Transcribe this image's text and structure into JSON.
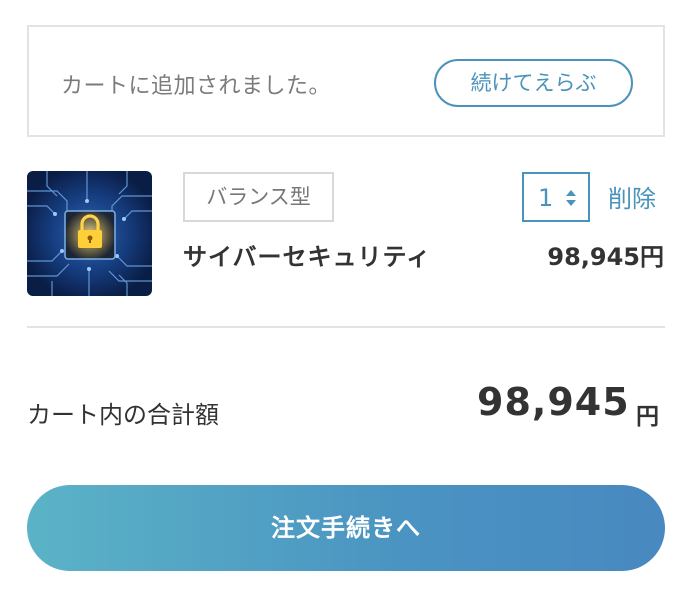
{
  "notice": {
    "message": "カートに追加されました。",
    "continue_label": "続けてえらぶ"
  },
  "item": {
    "image_icon": "padlock-circuit-image",
    "type_label": "バランス型",
    "name": "サイバーセキュリティ",
    "quantity": "1",
    "delete_label": "削除",
    "price": "98,945円"
  },
  "total": {
    "label": "カート内の合計額",
    "amount": "98,945",
    "unit": "円"
  },
  "checkout": {
    "label": "注文手続きへ"
  },
  "colors": {
    "accent": "#4a93bb",
    "checkout_gradient_start": "#5bb3c6",
    "checkout_gradient_end": "#4889c0",
    "border": "#e3e3e3"
  }
}
